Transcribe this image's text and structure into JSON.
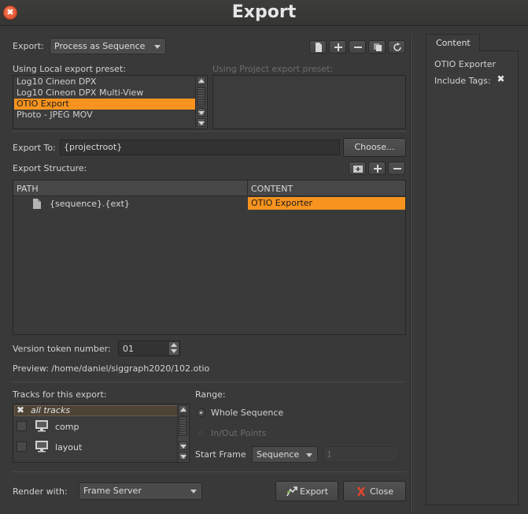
{
  "window": {
    "title": "Export",
    "close_icon": "✖"
  },
  "export_mode": {
    "label": "Export:",
    "value": "Process as Sequence"
  },
  "local_presets": {
    "label": "Using Local export preset:",
    "items": [
      "Log10 Cineon DPX",
      "Log10 Cineon DPX Multi-View",
      "OTIO Export",
      "Photo - JPEG MOV"
    ],
    "selected_index": 2
  },
  "project_presets": {
    "label": "Using Project export preset:"
  },
  "export_to": {
    "label": "Export To:",
    "value": "{projectroot}",
    "choose_label": "Choose..."
  },
  "structure": {
    "label": "Export Structure:",
    "col_path": "PATH",
    "col_content": "CONTENT",
    "rows": [
      {
        "path": "{sequence}.{ext}",
        "content": "OTIO Exporter"
      }
    ]
  },
  "version": {
    "label": "Version token number:",
    "value": "01"
  },
  "preview": {
    "text": "Preview: /home/daniel/siggraph2020/102.otio"
  },
  "tracks": {
    "label": "Tracks for this export:",
    "items": [
      {
        "name": "all tracks",
        "checked": true,
        "italic": true
      },
      {
        "name": "comp",
        "checked": false
      },
      {
        "name": "layout",
        "checked": false
      }
    ]
  },
  "range": {
    "label": "Range:",
    "whole": "Whole Sequence",
    "inout": "In/Out Points",
    "start_frame_label": "Start Frame",
    "start_frame_mode": "Sequence",
    "start_frame_value": "1"
  },
  "render": {
    "label": "Render with:",
    "value": "Frame Server"
  },
  "buttons": {
    "export": "Export",
    "close": "Close"
  },
  "content_panel": {
    "tab": "Content",
    "title": "OTIO Exporter",
    "include_tags_label": "Include Tags:",
    "include_tags_mark": "✖"
  },
  "colors": {
    "accent": "#f7931e",
    "background": "#393939",
    "close_button": "#e0552e"
  }
}
